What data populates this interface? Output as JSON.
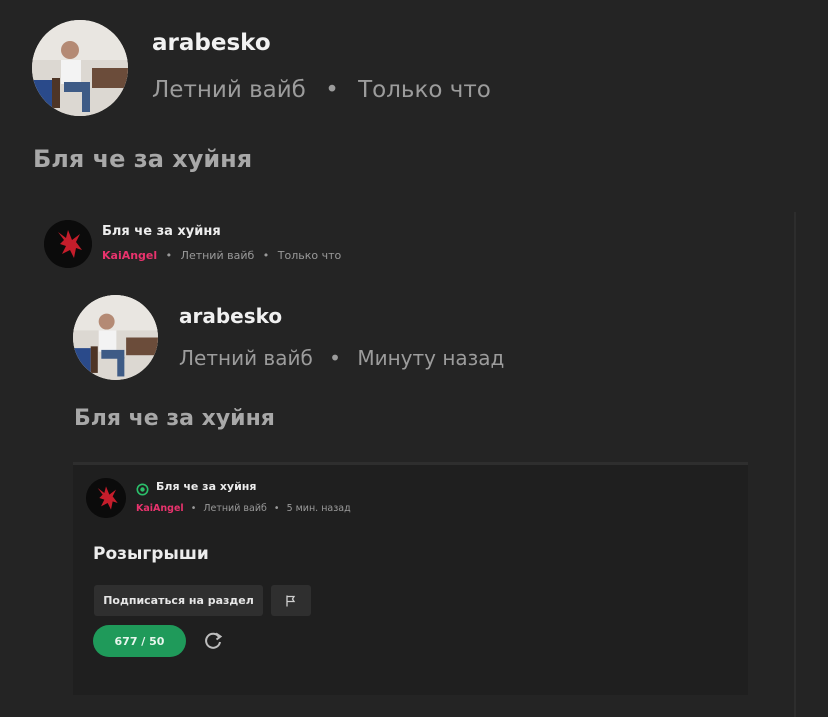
{
  "post": {
    "author": "arabesko",
    "section": "Летний вайб",
    "time": "Только что",
    "text": "Бля че за хуйня"
  },
  "embed1": {
    "title": "Бля че за хуйня",
    "author": "KaiAngel",
    "section": "Летний вайб",
    "time": "Только что"
  },
  "embed1_post": {
    "author": "arabesko",
    "section": "Летний вайб",
    "time": "Минуту назад",
    "text": "Бля че за хуйня"
  },
  "embed2": {
    "title": "Бля че за хуйня",
    "author": "KaiAngel",
    "section": "Летний вайб",
    "time": "5 мин. назад",
    "heading": "Розыгрыши",
    "subscribe_label": "Подписаться на раздел",
    "counter_label": "677 / 50"
  },
  "separator": "•",
  "colors": {
    "background": "#242424",
    "accent_pink": "#e8336d",
    "accent_green": "#1f9a5a",
    "status_green": "#2bbf6a"
  },
  "icons": [
    "user-avatar",
    "demon-avatar-icon",
    "status-ring-icon",
    "flag-icon",
    "refresh-icon"
  ]
}
